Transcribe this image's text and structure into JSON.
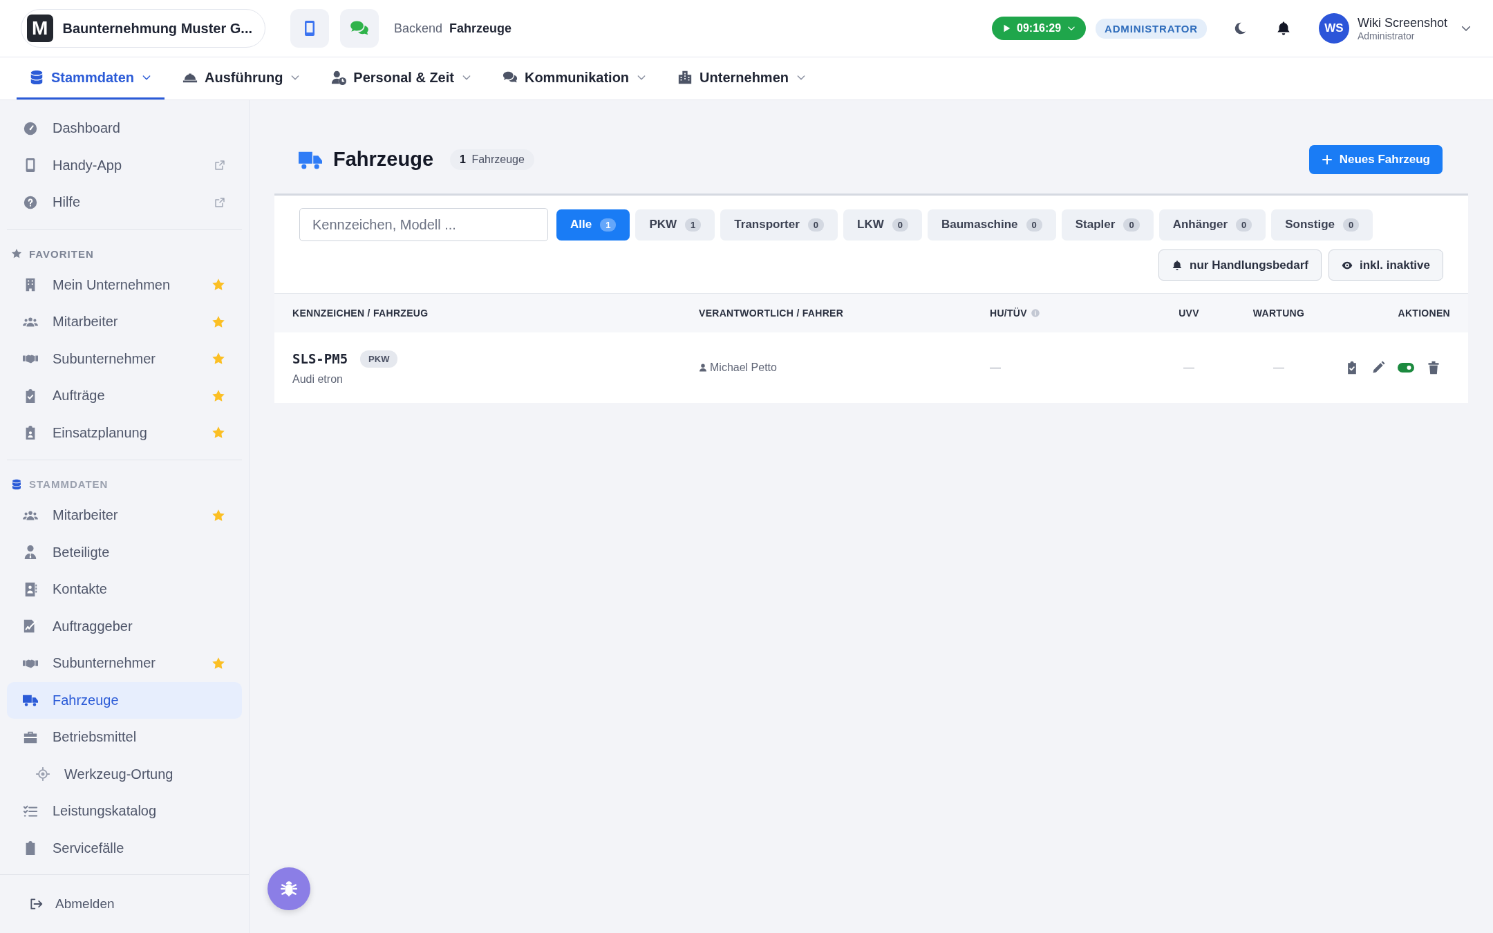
{
  "header": {
    "logo_text": "M",
    "company": "Baunternehmung Muster G...",
    "breadcrumb": [
      "Backend",
      "Fahrzeuge"
    ],
    "timer": "09:16:29",
    "role_badge": "ADMINISTRATOR",
    "user": {
      "initials": "WS",
      "name": "Wiki Screenshot",
      "role": "Administrator"
    }
  },
  "menu": [
    {
      "label": "Stammdaten",
      "selected": true
    },
    {
      "label": "Ausführung",
      "selected": false
    },
    {
      "label": "Personal & Zeit",
      "selected": false
    },
    {
      "label": "Kommunikation",
      "selected": false
    },
    {
      "label": "Unternehmen",
      "selected": false
    }
  ],
  "sidebar": {
    "top": [
      {
        "label": "Dashboard",
        "external": false,
        "selected": false
      },
      {
        "label": "Handy-App",
        "external": true,
        "selected": false
      },
      {
        "label": "Hilfe",
        "external": true,
        "selected": false
      }
    ],
    "sections": [
      {
        "title": "FAVORITEN",
        "kind": "favorites",
        "items": [
          {
            "label": "Mein Unternehmen",
            "favorite": true,
            "selected": false
          },
          {
            "label": "Mitarbeiter",
            "favorite": true,
            "selected": false
          },
          {
            "label": "Subunternehmer",
            "favorite": true,
            "selected": false
          },
          {
            "label": "Aufträge",
            "favorite": true,
            "selected": false
          },
          {
            "label": "Einsatzplanung",
            "favorite": true,
            "selected": false
          }
        ]
      },
      {
        "title": "STAMMDATEN",
        "kind": "module",
        "items": [
          {
            "label": "Mitarbeiter",
            "favorite": true,
            "selected": false
          },
          {
            "label": "Beteiligte",
            "favorite": false,
            "selected": false
          },
          {
            "label": "Kontakte",
            "favorite": false,
            "selected": false
          },
          {
            "label": "Auftraggeber",
            "favorite": false,
            "selected": false
          },
          {
            "label": "Subunternehmer",
            "favorite": true,
            "selected": false
          },
          {
            "label": "Fahrzeuge",
            "favorite": false,
            "selected": true
          },
          {
            "label": "Betriebsmittel",
            "favorite": false,
            "selected": false,
            "children": [
              {
                "label": "Werkzeug-Ortung",
                "favorite": false,
                "selected": false
              }
            ]
          },
          {
            "label": "Leistungskatalog",
            "favorite": false,
            "selected": false
          },
          {
            "label": "Servicefälle",
            "favorite": false,
            "selected": false
          }
        ]
      }
    ],
    "logout": "Abmelden"
  },
  "page": {
    "title": "Fahrzeuge",
    "count": "1",
    "count_label": "Fahrzeuge",
    "new_button": "Neues Fahrzeug"
  },
  "search": {
    "placeholder": "Kennzeichen, Modell ..."
  },
  "filters": [
    {
      "label": "Alle",
      "count": "1",
      "selected": true
    },
    {
      "label": "PKW",
      "count": "1",
      "selected": false
    },
    {
      "label": "Transporter",
      "count": "0",
      "selected": false
    },
    {
      "label": "LKW",
      "count": "0",
      "selected": false
    },
    {
      "label": "Baumaschine",
      "count": "0",
      "selected": false
    },
    {
      "label": "Stapler",
      "count": "0",
      "selected": false
    },
    {
      "label": "Anhänger",
      "count": "0",
      "selected": false
    },
    {
      "label": "Sonstige",
      "count": "0",
      "selected": false
    }
  ],
  "toggles": [
    {
      "label": "nur Handlungsbedarf",
      "on": false
    },
    {
      "label": "inkl. inaktive",
      "on": false
    }
  ],
  "table": {
    "columns": [
      "KENNZEICHEN / FAHRZEUG",
      "VERANTWORTLICH / FAHRER",
      "HU/TÜV",
      "UVV",
      "WARTUNG",
      "AKTIONEN"
    ],
    "rows": [
      {
        "plate": "SLS-PM5",
        "type": "PKW",
        "model": "Audi etron",
        "driver": "Michael Petto",
        "hu": "—",
        "uvv": "—",
        "wartung": "—",
        "active": true
      }
    ]
  }
}
